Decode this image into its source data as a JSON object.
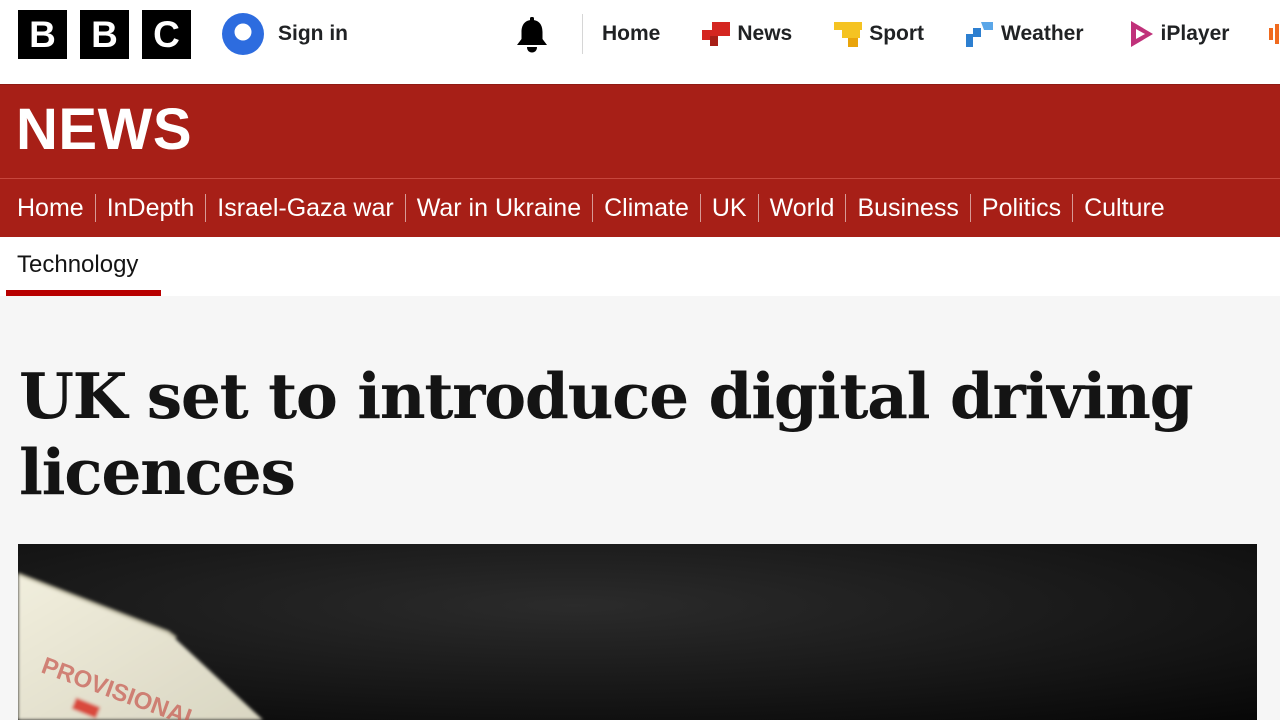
{
  "brand": {
    "letters": [
      "B",
      "B",
      "C"
    ]
  },
  "account": {
    "sign_in_label": "Sign in"
  },
  "top_nav": {
    "items": [
      {
        "label": "Home",
        "icon": "none"
      },
      {
        "label": "News",
        "icon": "news-icon"
      },
      {
        "label": "Sport",
        "icon": "sport-icon"
      },
      {
        "label": "Weather",
        "icon": "weather-icon"
      },
      {
        "label": "iPlayer",
        "icon": "iplayer-icon"
      }
    ]
  },
  "news_banner": {
    "wordmark": "NEWS"
  },
  "section_nav": {
    "items": [
      "Home",
      "InDepth",
      "Israel-Gaza war",
      "War in Ukraine",
      "Climate",
      "UK",
      "World",
      "Business",
      "Politics",
      "Culture"
    ]
  },
  "subnav": {
    "active_tab": "Technology"
  },
  "article": {
    "headline": "UK set to introduce digital driving licences",
    "hero_card_text": "PROVISIONAL"
  },
  "colors": {
    "news_red": "#a71f17",
    "active_underline": "#b80000",
    "page_background": "#f6f6f6",
    "avatar_blue": "#2d6cdf",
    "news_icon_red": "#d42620",
    "sport_icon_yellow": "#f5c322",
    "weather_icon_blue": "#2d7fd0",
    "iplayer_icon_pink": "#c0317a"
  }
}
